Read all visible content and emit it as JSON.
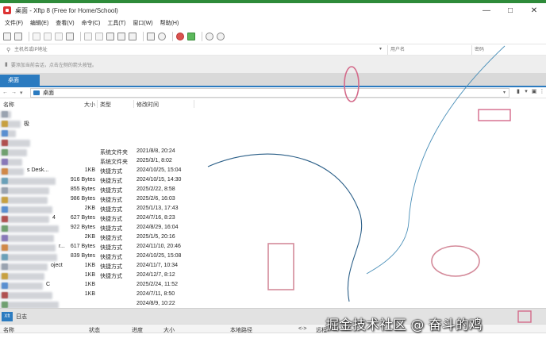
{
  "window": {
    "title": "桌面 - Xftp 8 (Free for Home/School)",
    "controls": [
      "—",
      "□",
      "✕"
    ]
  },
  "menu": [
    "文件(F)",
    "编辑(E)",
    "查看(V)",
    "命令(C)",
    "工具(T)",
    "窗口(W)",
    "帮助(H)"
  ],
  "address": {
    "host_placeholder": "主机名或IP地址",
    "user_placeholder": "用户名",
    "password_placeholder": "密码"
  },
  "hint": {
    "text": "要添加当前会话，点击左侧的箭头按钮。"
  },
  "tab": {
    "label": "桌面"
  },
  "path": {
    "current": "桌面"
  },
  "columns": {
    "name": "名称",
    "size": "大小",
    "type": "类型",
    "modified": "修改时间"
  },
  "files": [
    {
      "name": "",
      "size": "",
      "type": "",
      "modified": ""
    },
    {
      "name": "极",
      "size": "",
      "type": "",
      "modified": ""
    },
    {
      "name": "",
      "size": "",
      "type": "",
      "modified": ""
    },
    {
      "name": "",
      "size": "",
      "type": "",
      "modified": ""
    },
    {
      "name": "",
      "size": "",
      "type": "系统文件夹",
      "modified": "2021/8/8, 20:24"
    },
    {
      "name": "",
      "size": "",
      "type": "系统文件夹",
      "modified": "2025/3/1, 8:02"
    },
    {
      "name": "s Desk...",
      "size": "1KB",
      "type": "快捷方式",
      "modified": "2024/10/25, 15:04"
    },
    {
      "name": "",
      "size": "916 Bytes",
      "type": "快捷方式",
      "modified": "2024/10/15, 14:30"
    },
    {
      "name": "",
      "size": "855 Bytes",
      "type": "快捷方式",
      "modified": "2025/2/22, 8:58"
    },
    {
      "name": "",
      "size": "986 Bytes",
      "type": "快捷方式",
      "modified": "2025/2/6, 16:03"
    },
    {
      "name": "",
      "size": "2KB",
      "type": "快捷方式",
      "modified": "2025/1/13, 17:43"
    },
    {
      "name": "4",
      "size": "627 Bytes",
      "type": "快捷方式",
      "modified": "2024/7/16, 8:23"
    },
    {
      "name": "",
      "size": "922 Bytes",
      "type": "快捷方式",
      "modified": "2024/8/29, 16:04"
    },
    {
      "name": "",
      "size": "2KB",
      "type": "快捷方式",
      "modified": "2025/1/5, 20:16"
    },
    {
      "name": "r...",
      "size": "617 Bytes",
      "type": "快捷方式",
      "modified": "2024/11/10, 20:46"
    },
    {
      "name": "",
      "size": "839 Bytes",
      "type": "快捷方式",
      "modified": "2024/10/25, 15:08"
    },
    {
      "name": "oject",
      "size": "1KB",
      "type": "快捷方式",
      "modified": "2024/11/7, 10:34"
    },
    {
      "name": "",
      "size": "1KB",
      "type": "快捷方式",
      "modified": "2024/12/7, 8:12"
    },
    {
      "name": "C",
      "size": "1KB",
      "type": "",
      "modified": "2025/2/24, 11:52"
    },
    {
      "name": "",
      "size": "1KB",
      "type": "",
      "modified": "2024/7/11, 8:50"
    },
    {
      "name": "",
      "size": "",
      "type": "",
      "modified": "2024/8/9, 10:22"
    }
  ],
  "log": {
    "badge": "Xft",
    "label": "日志"
  },
  "transfer_columns": [
    "名称",
    "状态",
    "进度",
    "大小",
    "本地路径",
    "<->",
    "远程"
  ],
  "watermark": {
    "text": "掘金技术社区 @ 奋斗的鸡"
  },
  "colors": {
    "accent": "#2b7bc0",
    "top_strip": "#2e8b3a",
    "annotation": "#d46a8a",
    "curve": "#4a7fa8"
  }
}
